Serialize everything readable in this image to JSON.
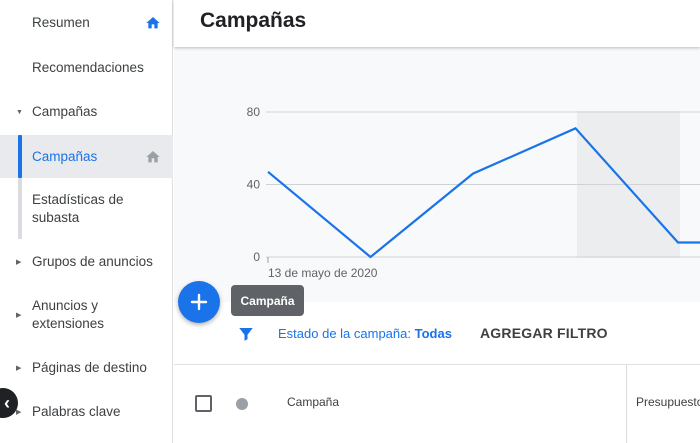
{
  "sidebar": {
    "items": [
      {
        "label": "Resumen"
      },
      {
        "label": "Recomendaciones"
      },
      {
        "label": "Campañas"
      },
      {
        "label": "Campañas"
      },
      {
        "label": "Estadísticas de subasta"
      },
      {
        "label": "Grupos de anuncios"
      },
      {
        "label": "Anuncios y extensiones"
      },
      {
        "label": "Páginas de destino"
      },
      {
        "label": "Palabras clave"
      }
    ]
  },
  "header": {
    "title": "Campañas"
  },
  "fab": {
    "tooltip": "Campaña"
  },
  "filter": {
    "label": "Estado de la campaña:",
    "value": "Todas",
    "add_filter": "AGREGAR FILTRO"
  },
  "table": {
    "columns": [
      "Campaña",
      "Presupuesto"
    ]
  },
  "chart_data": {
    "type": "line",
    "x_start_label": "13 de mayo de 2020",
    "y_ticks": [
      "80",
      "40",
      "0"
    ],
    "ylim": [
      0,
      80
    ],
    "series": [
      {
        "values": [
          47,
          0,
          46,
          71,
          8,
          8
        ]
      }
    ],
    "colors": {
      "line": "#1a73e8"
    }
  },
  "colors": {
    "accent": "#1a73e8"
  }
}
